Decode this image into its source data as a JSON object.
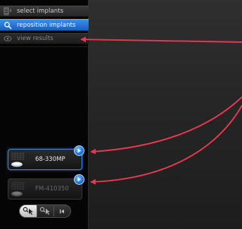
{
  "menu": {
    "select_implants": "select implants",
    "reposition_implants": "reposition implants",
    "view_results": "view results"
  },
  "implants": [
    {
      "label": "68-330MP",
      "state": "active"
    },
    {
      "label": "FM-410350",
      "state": "inactive"
    }
  ],
  "toolbar": {
    "tools": [
      "select-tool",
      "reposition-tool",
      "previous-tool"
    ]
  },
  "colors": {
    "accent_blue": "#2a7ae0",
    "annotation_red": "#e8384f",
    "background": "#262626"
  }
}
